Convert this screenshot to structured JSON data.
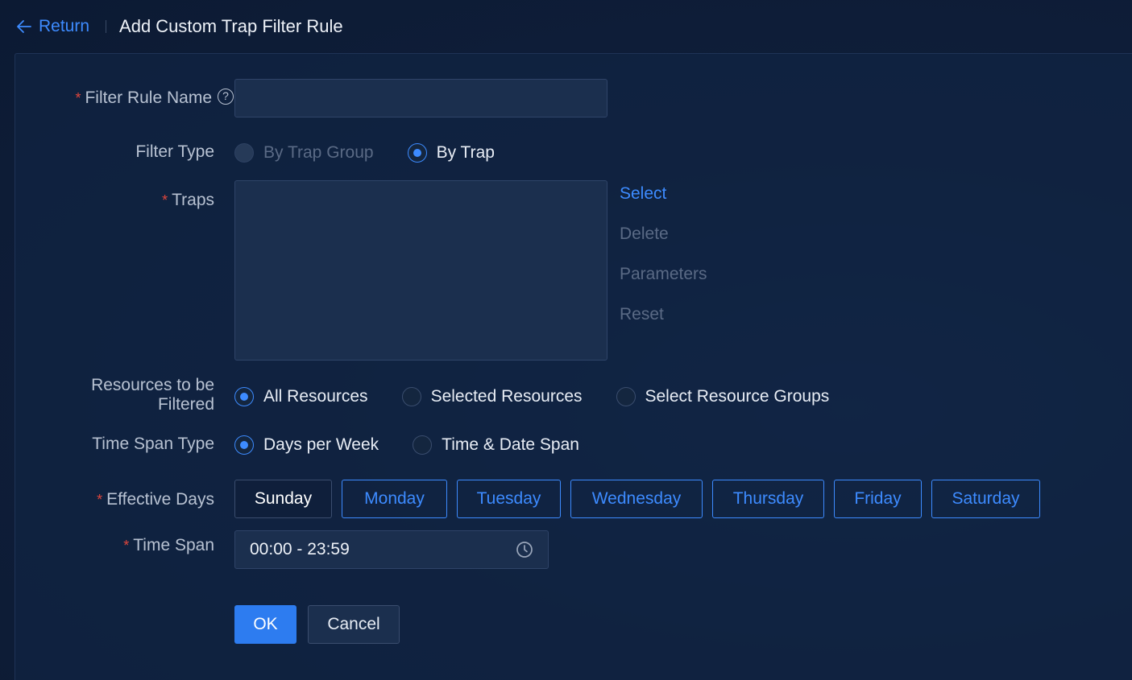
{
  "header": {
    "return_label": "Return",
    "title": "Add Custom Trap Filter Rule"
  },
  "form": {
    "filter_rule_name": {
      "label": "Filter Rule Name",
      "help_glyph": "?",
      "value": ""
    },
    "filter_type": {
      "label": "Filter Type",
      "options": [
        "By Trap Group",
        "By Trap"
      ],
      "selected": "By Trap",
      "disabled": [
        "By Trap Group"
      ]
    },
    "traps": {
      "label": "Traps",
      "actions": [
        "Select",
        "Delete",
        "Parameters",
        "Reset"
      ]
    },
    "resources": {
      "label_line1": "Resources to be",
      "label_line2": "Filtered",
      "options": [
        "All Resources",
        "Selected Resources",
        "Select Resource Groups"
      ],
      "selected": "All Resources"
    },
    "time_span_type": {
      "label": "Time Span Type",
      "options": [
        "Days per Week",
        "Time & Date Span"
      ],
      "selected": "Days per Week"
    },
    "effective_days": {
      "label": "Effective Days",
      "days": [
        "Sunday",
        "Monday",
        "Tuesday",
        "Wednesday",
        "Thursday",
        "Friday",
        "Saturday"
      ],
      "selected": [
        "Sunday"
      ]
    },
    "time_span": {
      "label": "Time Span",
      "value": "00:00 - 23:59"
    },
    "required_marker": "*"
  },
  "buttons": {
    "ok": "OK",
    "cancel": "Cancel"
  },
  "colors": {
    "accent": "#3d8bff",
    "required": "#e0463c",
    "background": "#0e1c36"
  }
}
